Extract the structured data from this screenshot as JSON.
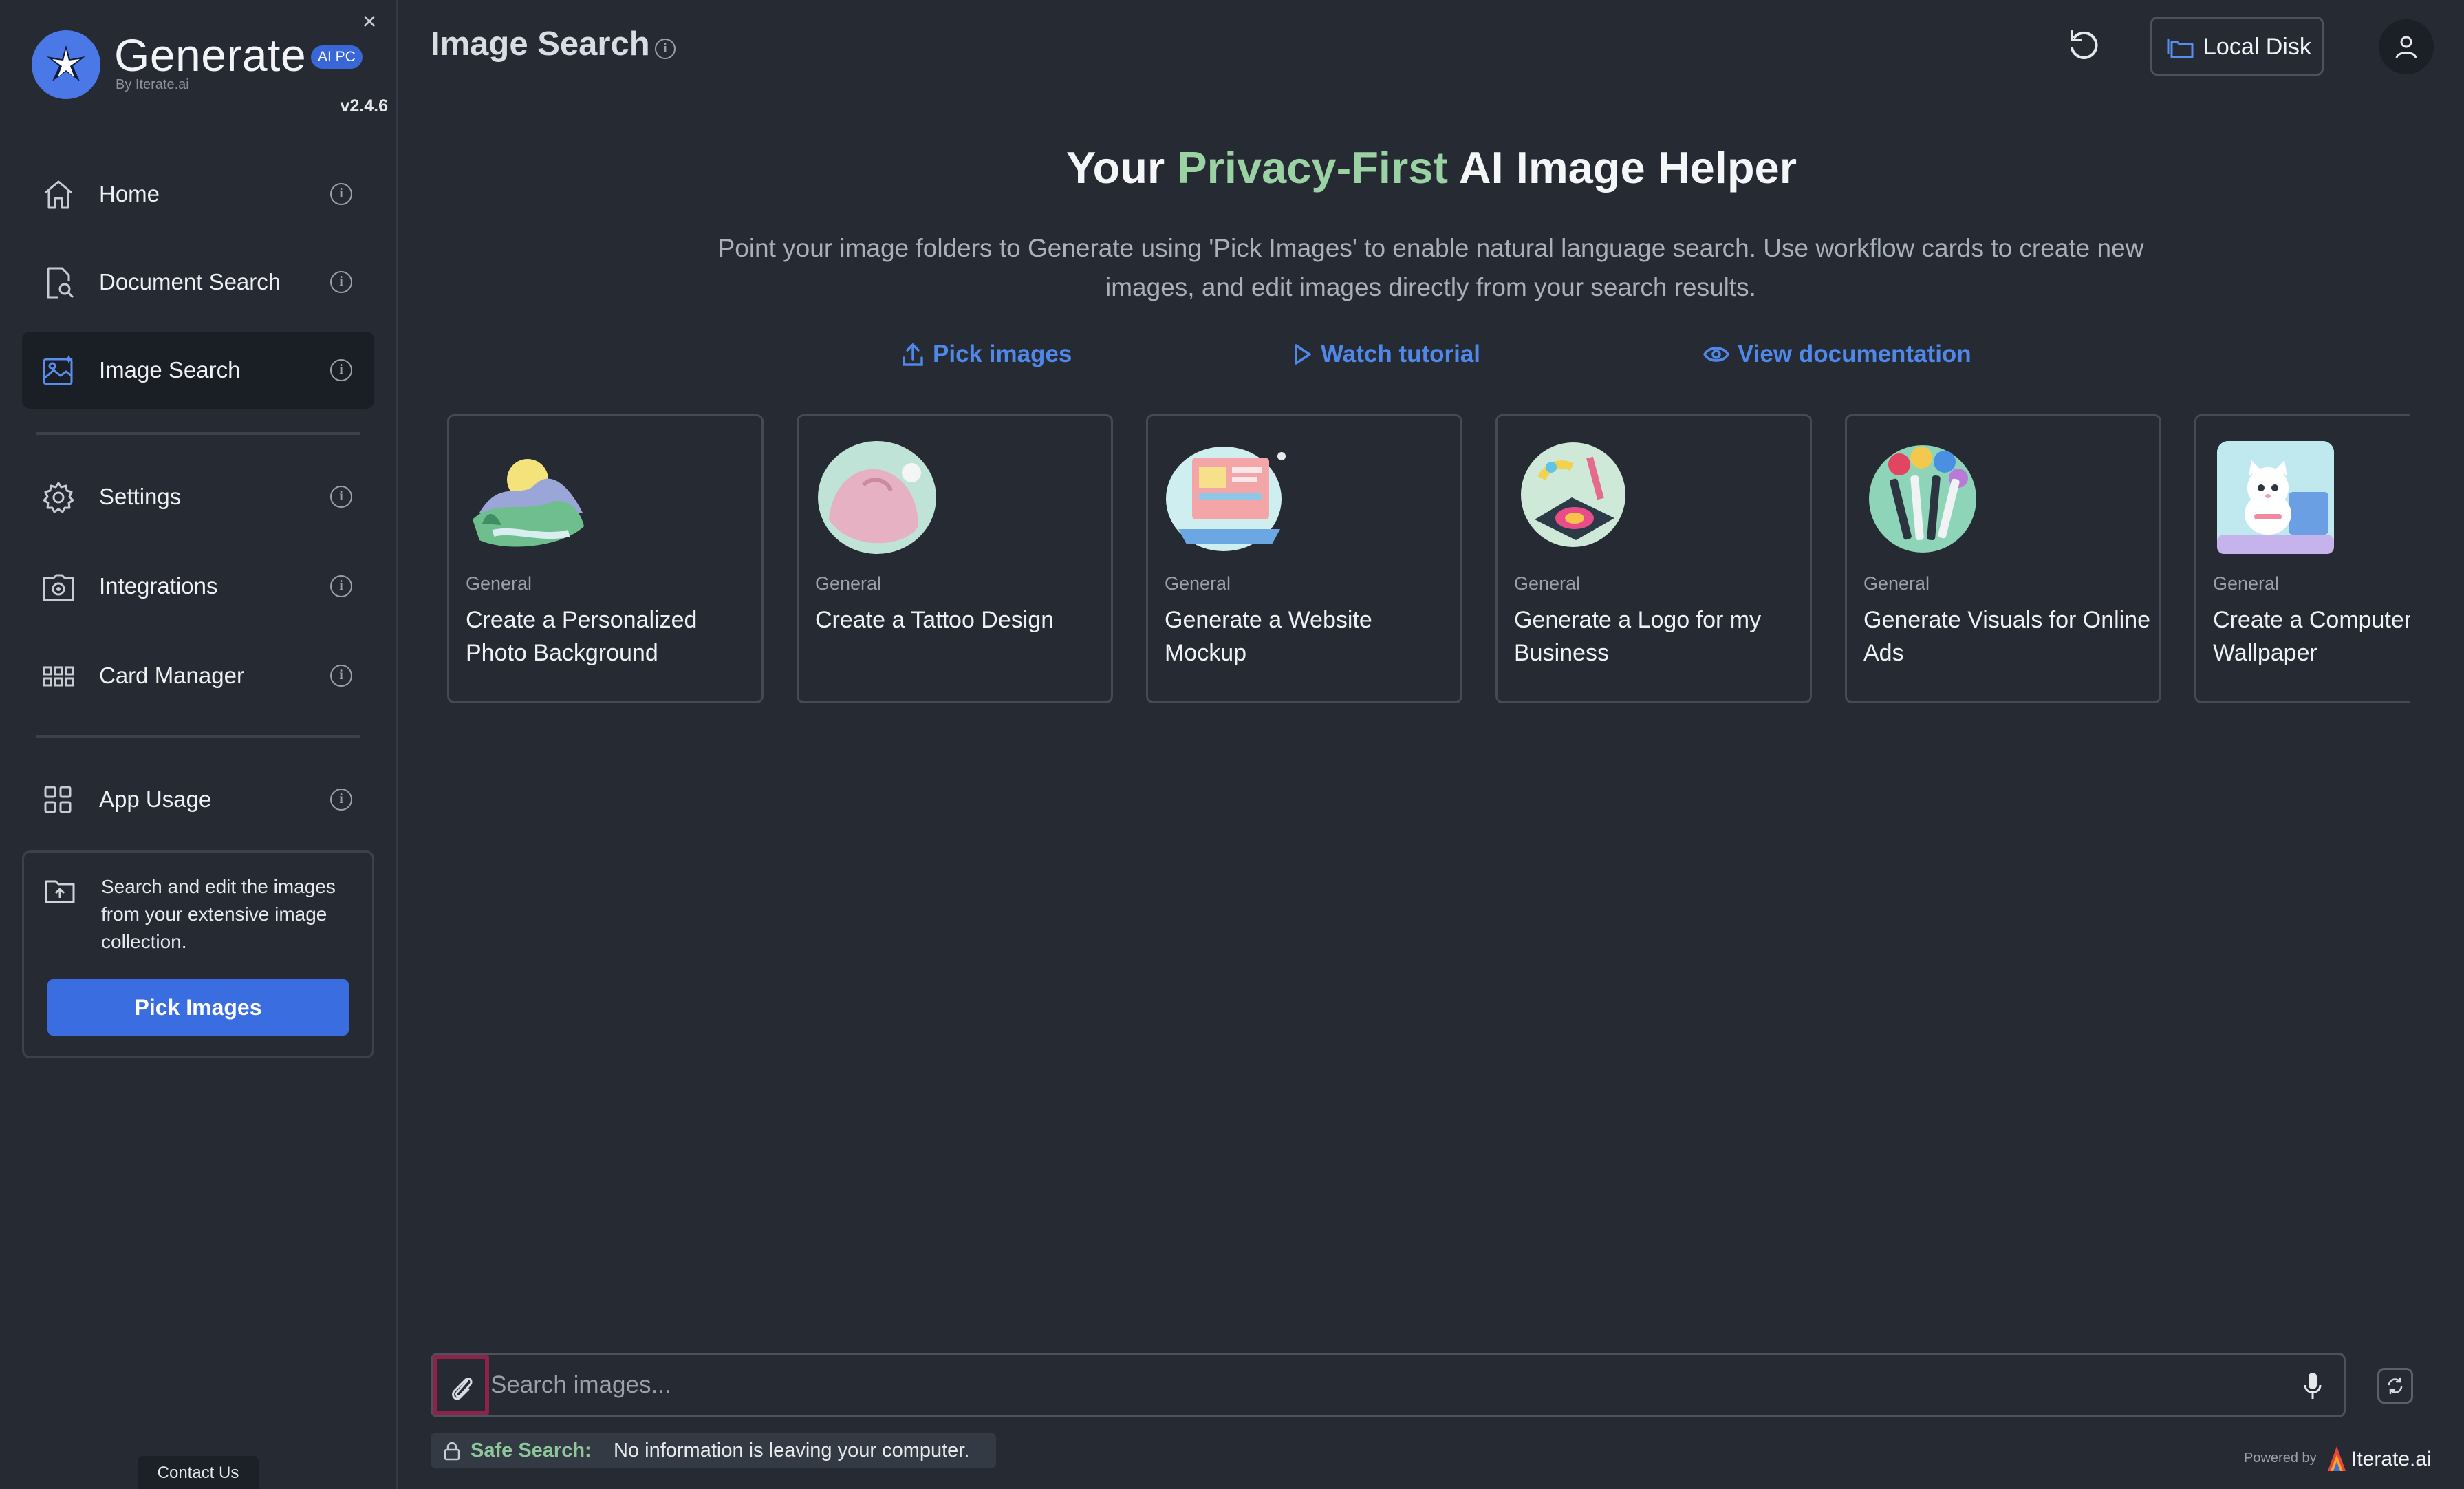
{
  "sidebar": {
    "brand_name": "Generate",
    "brand_badge": "AI PC",
    "brand_by": "By Iterate.ai",
    "version": "v2.4.6",
    "close_glyph": "×",
    "items": [
      {
        "label": "Home",
        "icon": "home-icon"
      },
      {
        "label": "Document Search",
        "icon": "document-search-icon"
      },
      {
        "label": "Image Search",
        "icon": "image-icon",
        "active": true
      },
      {
        "label": "Settings",
        "icon": "gear-icon"
      },
      {
        "label": "Integrations",
        "icon": "integrations-icon"
      },
      {
        "label": "Card Manager",
        "icon": "grid-icon"
      },
      {
        "label": "App Usage",
        "icon": "apps-icon"
      }
    ],
    "info_glyph": "i",
    "promo": {
      "text": "Search and edit the images from your extensive image collection.",
      "button": "Pick Images"
    },
    "contact": "Contact Us"
  },
  "header": {
    "title": "Image Search",
    "info_glyph": "i",
    "storage_button": "Local Disk"
  },
  "hero": {
    "title_before": "Your ",
    "title_accent": "Privacy-First",
    "title_after": " AI Image Helper",
    "description": "Point your image folders to Generate using 'Pick Images' to enable natural language search. Use workflow cards to create new images, and edit images directly from your search results.",
    "links": [
      {
        "label": "Pick images",
        "icon": "upload-icon"
      },
      {
        "label": "Watch tutorial",
        "icon": "play-icon"
      },
      {
        "label": "View documentation",
        "icon": "eye-icon"
      }
    ]
  },
  "cards": [
    {
      "category": "General",
      "title": "Create a Personalized Photo Background"
    },
    {
      "category": "General",
      "title": "Create a Tattoo Design"
    },
    {
      "category": "General",
      "title": "Generate a Website Mockup"
    },
    {
      "category": "General",
      "title": "Generate a Logo for my Business"
    },
    {
      "category": "General",
      "title": "Generate Visuals for Online Ads"
    },
    {
      "category": "General",
      "title": "Create a Computer Wallpaper"
    }
  ],
  "search": {
    "placeholder": "Search images...",
    "value": ""
  },
  "footer": {
    "safe_label": "Safe Search:",
    "safe_text": "No information is leaving your computer.",
    "powered_by": "Powered by",
    "powered_name": "Iterate.ai"
  },
  "colors": {
    "background": "#262b33",
    "accent_blue": "#3a6ee0",
    "accent_green": "#9ad2a4",
    "highlight": "#8c2349"
  }
}
